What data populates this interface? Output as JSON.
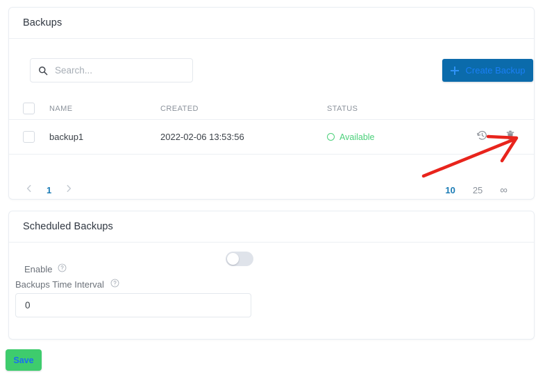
{
  "backups_card": {
    "title": "Backups",
    "search": {
      "placeholder": "Search...",
      "value": "",
      "icon": "search-icon"
    },
    "create_button": {
      "label": "Create Backup",
      "icon": "plus-icon",
      "bg_color": "#0b6bab",
      "text_color": "#1a7ff5"
    },
    "table": {
      "columns": [
        "NAME",
        "CREATED",
        "STATUS"
      ],
      "rows": [
        {
          "name": "backup1",
          "created": "2022-02-06 13:53:56",
          "status": "Available",
          "status_color": "#4bd07a",
          "actions": [
            "restore-icon",
            "delete-icon"
          ]
        }
      ]
    },
    "pagination": {
      "prev_icon": "chevron-left-icon",
      "next_icon": "chevron-right-icon",
      "current_page": "1",
      "page_sizes": [
        "10",
        "25",
        "∞"
      ],
      "active_page_size": "10",
      "active_color": "#1a7bb5"
    }
  },
  "scheduled_card": {
    "title": "Scheduled Backups",
    "enable": {
      "label": "Enable",
      "help_icon": "help-circle-icon",
      "toggle_state": "off"
    },
    "interval": {
      "label": "Backups Time Interval",
      "help_icon": "help-circle-icon",
      "value": "0"
    }
  },
  "save_button": {
    "label": "Save",
    "bg_color": "#3ecc6d",
    "text_color": "#1a6ef0"
  },
  "annotation": {
    "type": "arrow",
    "color": "#e8241c",
    "points_to": "delete-icon"
  }
}
